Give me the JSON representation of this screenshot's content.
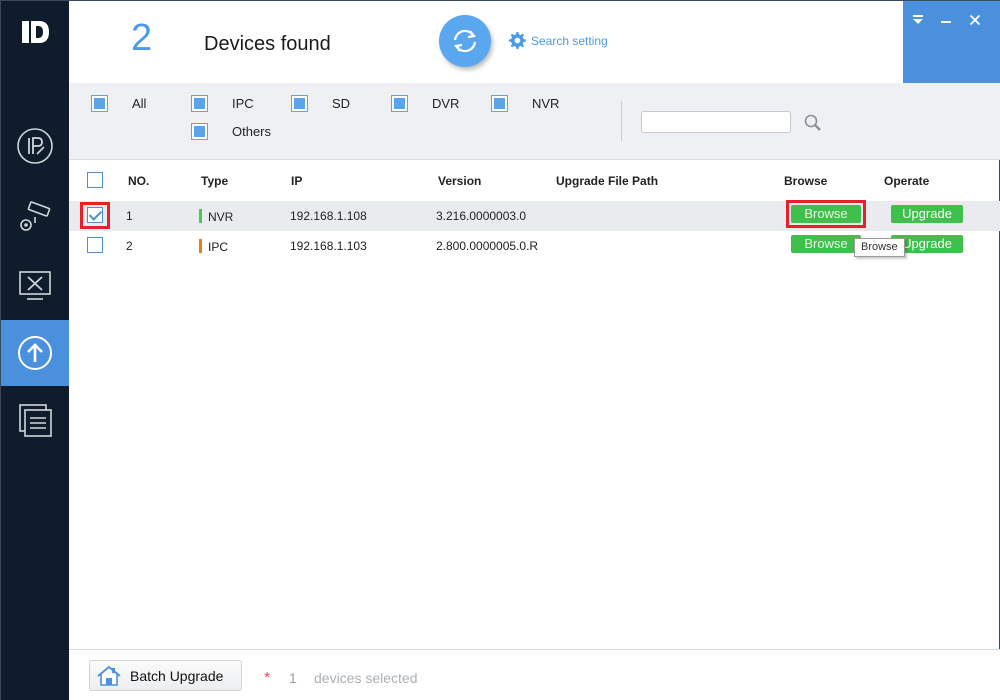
{
  "header": {
    "device_count": "2",
    "found_label": "Devices found",
    "search_setting_label": "Search setting"
  },
  "filters": {
    "all": "All",
    "ipc": "IPC",
    "sd": "SD",
    "dvr": "DVR",
    "nvr": "NVR",
    "others": "Others",
    "search_value": ""
  },
  "table": {
    "columns": {
      "no": "NO.",
      "type": "Type",
      "ip": "IP",
      "version": "Version",
      "path": "Upgrade File Path",
      "browse": "Browse",
      "operate": "Operate"
    },
    "rows": [
      {
        "no": "1",
        "type": "NVR",
        "type_color": "#3fcf4b",
        "ip": "192.168.1.108",
        "version": "3.216.0000003.0",
        "path": "",
        "browse": "Browse",
        "operate": "Upgrade",
        "checked": true
      },
      {
        "no": "2",
        "type": "IPC",
        "type_color": "#f07b1a",
        "ip": "192.168.1.103",
        "version": "2.800.0000005.0.R",
        "path": "",
        "browse": "Browse",
        "operate": "Upgrade",
        "checked": false
      }
    ]
  },
  "tooltip": "Browse",
  "footer": {
    "batch_label": "Batch Upgrade",
    "selected_count": "1",
    "selected_text": "devices selected"
  },
  "colors": {
    "accent": "#4b90dc",
    "sidebar": "#0f1c2b",
    "green_button": "#3fbf4b",
    "highlight": "#e8202a"
  }
}
